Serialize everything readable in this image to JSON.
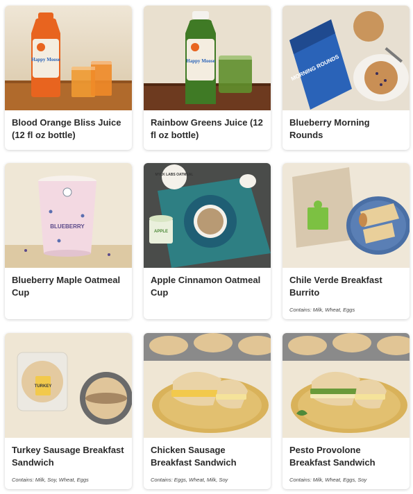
{
  "products": [
    {
      "name": "Blood Orange Bliss Juice (12 fl oz bottle)",
      "contains": "",
      "brand": "Happy Moose"
    },
    {
      "name": "Rainbow Greens Juice (12 fl oz bottle)",
      "contains": "",
      "brand": "Happy Moose"
    },
    {
      "name": "Blueberry Morning Rounds",
      "contains": "",
      "package_text": "MORNING ROUNDS"
    },
    {
      "name": "Blueberry Maple Oatmeal Cup",
      "contains": "",
      "package_text": "BLUEBERRY"
    },
    {
      "name": "Apple Cinnamon Oatmeal Cup",
      "contains": "",
      "package_text": "MYLK LABS OATMEAL",
      "cup_text": "APPLE"
    },
    {
      "name": "Chile Verde Breakfast Burrito",
      "contains": "Contains: Milk, Wheat, Eggs"
    },
    {
      "name": "Turkey Sausage Breakfast Sandwich",
      "contains": "Contains: Milk, Soy, Wheat, Eggs",
      "package_text": "TURKEY"
    },
    {
      "name": "Chicken Sausage Breakfast Sandwich",
      "contains": "Contains: Eggs, Wheat, Milk, Soy"
    },
    {
      "name": "Pesto Provolone Breakfast Sandwich",
      "contains": "Contains: Milk, Wheat, Eggs, Soy"
    }
  ],
  "colors": {
    "blood_orange_juice": "#e8641f",
    "greens_juice": "#3f7a25",
    "morning_rounds_bag": "#2a63b8",
    "oatmeal_cup_pink": "#f3d9e2",
    "teal_cloth": "#2e7f83",
    "burrito_label": "#7cc142",
    "sandwich_plate": "#d9b25a"
  }
}
